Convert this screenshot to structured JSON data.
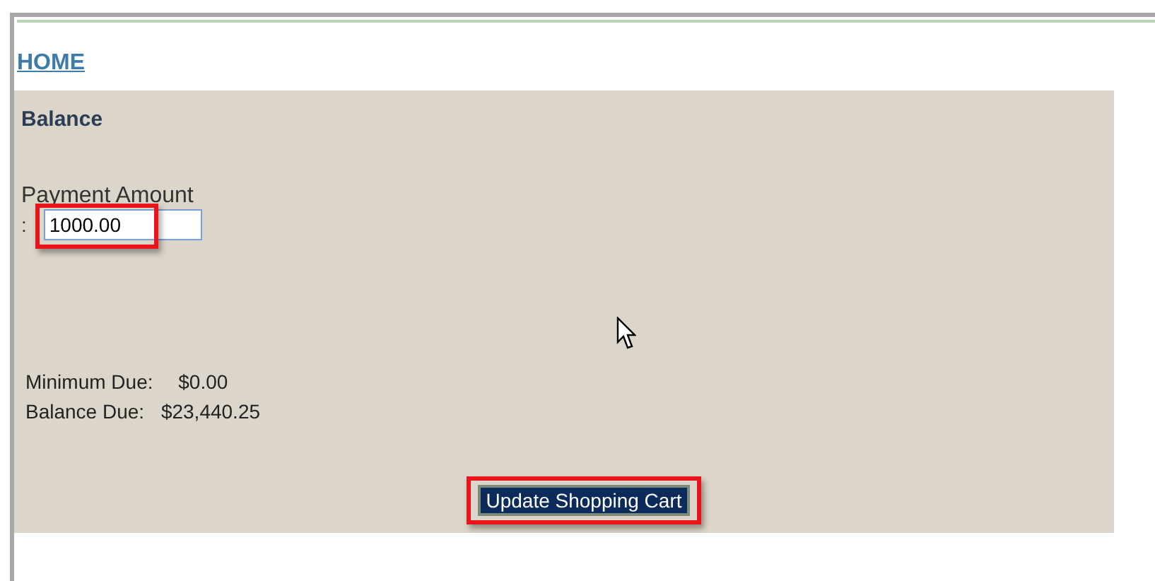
{
  "nav": {
    "home_link": "HOME"
  },
  "panel": {
    "title": "Balance",
    "payment": {
      "label": "Payment Amount",
      "separator": ":",
      "value": "1000.00"
    },
    "dues": [
      {
        "label": "Minimum Due:",
        "value": "$0.00"
      },
      {
        "label": "Balance Due:",
        "value": "$23,440.25"
      }
    ],
    "button": "Update Shopping Cart"
  }
}
